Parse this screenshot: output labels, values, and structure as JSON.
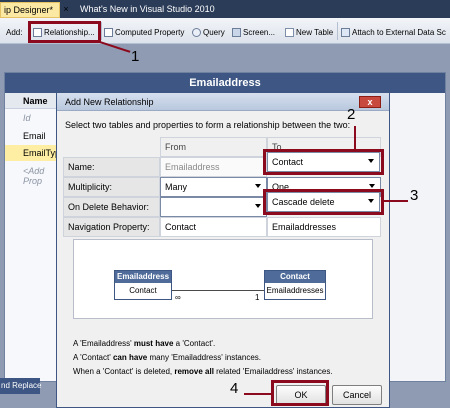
{
  "tabs": {
    "active_label": "ip Designer*",
    "close_glyph": "×",
    "inactive_label": "What's New in Visual Studio 2010"
  },
  "toolbar": {
    "add_label": "Add:",
    "relationship": "Relationship...",
    "computed_property": "Computed Property",
    "query": "Query",
    "screen": "Screen...",
    "new_table": "New Table",
    "attach": "Attach to External Data Sc"
  },
  "designer": {
    "title": "Emailaddress",
    "column_header": "Name",
    "rows": [
      "Id",
      "Email",
      "EmailType",
      "<Add Prop"
    ]
  },
  "dialog": {
    "title": "Add New Relationship",
    "close_glyph": "x",
    "instruction": "Select two tables and properties to form a relationship between the two:",
    "col_from": "From",
    "col_to": "To",
    "rows": {
      "name": {
        "label": "Name:",
        "from": "Emailaddress",
        "to": "Contact"
      },
      "multiplicity": {
        "label": "Multiplicity:",
        "from": "Many",
        "to": "One"
      },
      "delete": {
        "label": "On Delete Behavior:",
        "from": "",
        "to": "Cascade delete"
      },
      "navigation": {
        "label": "Navigation Property:",
        "from": "Contact",
        "to": "Emailaddresses"
      }
    },
    "diagram": {
      "left_title": "Emailaddress",
      "left_prop": "Contact",
      "right_title": "Contact",
      "right_prop": "Emailaddresses",
      "left_mult": "∞",
      "right_mult": "1"
    },
    "description": {
      "line1_a": "A 'Emailaddress' ",
      "line1_b": "must have",
      "line1_c": " a 'Contact'.",
      "line2_a": "A 'Contact' ",
      "line2_b": "can have",
      "line2_c": " many 'Emailaddress' instances.",
      "line3_a": "When a 'Contact' is deleted, ",
      "line3_b": "remove all",
      "line3_c": " related 'Emailaddress' instances."
    },
    "ok": "OK",
    "cancel": "Cancel"
  },
  "callouts": {
    "c1": "1",
    "c2": "2",
    "c3": "3",
    "c4": "4"
  },
  "bottom_text": "nd Replace",
  "accent_color": "#8b0a1d"
}
